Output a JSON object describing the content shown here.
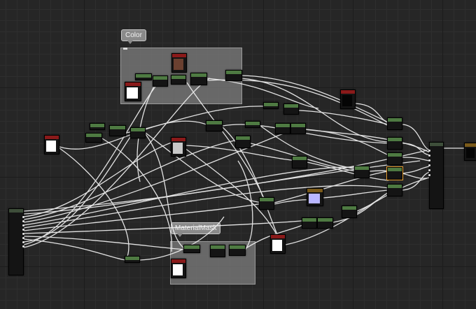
{
  "editor": {
    "comments": [
      {
        "label": "Color"
      },
      {
        "label": "MaterialMask"
      }
    ]
  },
  "colors": {
    "background": "#262626",
    "wire": "#ffffff",
    "node_header_green": "#4e7a42",
    "node_header_red": "#8a1a1a",
    "comment_fill": "#828282",
    "selection": "#e8a030"
  },
  "node_types": [
    "parameter-node",
    "math-node",
    "texture-sample-node",
    "vector-param-node",
    "material-output-node"
  ]
}
